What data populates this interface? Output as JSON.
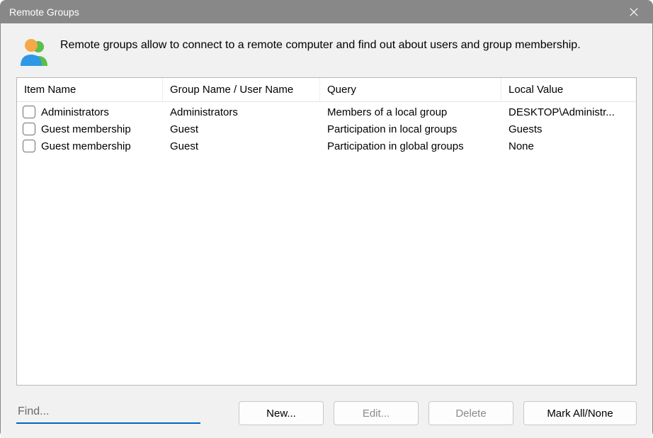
{
  "window": {
    "title": "Remote Groups"
  },
  "description": "Remote groups allow to connect to a remote computer and find out about users and group membership.",
  "table": {
    "headers": {
      "item": "Item Name",
      "group": "Group Name / User Name",
      "query": "Query",
      "local": "Local Value"
    },
    "rows": [
      {
        "item": "Administrators",
        "group": "Administrators",
        "query": "Members of a local group",
        "local": "DESKTOP\\Administr..."
      },
      {
        "item": "Guest membership",
        "group": "Guest",
        "query": "Participation in local groups",
        "local": "Guests"
      },
      {
        "item": "Guest membership",
        "group": "Guest",
        "query": "Participation in global groups",
        "local": "None"
      }
    ]
  },
  "find": {
    "placeholder": "Find..."
  },
  "buttons": {
    "new": "New...",
    "edit": "Edit...",
    "delete": "Delete",
    "markall": "Mark All/None"
  }
}
